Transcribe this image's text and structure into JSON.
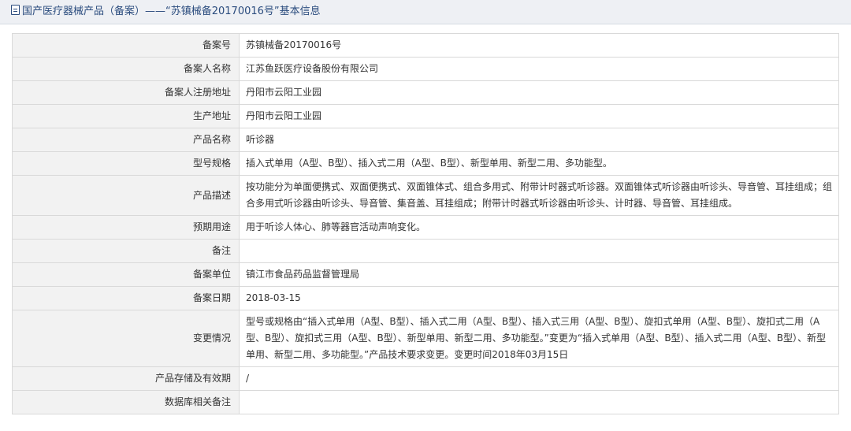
{
  "header": {
    "title": "国产医疗器械产品（备案）——“苏镇械备20170016号”基本信息",
    "icon": "document-icon"
  },
  "colors": {
    "title_text": "#2b4c7e",
    "title_bg": "#eef0f4",
    "label_bg": "#f2f2f2",
    "border": "#d9d9d9"
  },
  "rows": [
    {
      "label": "备案号",
      "value": "苏镇械备20170016号"
    },
    {
      "label": "备案人名称",
      "value": "江苏鱼跃医疗设备股份有限公司"
    },
    {
      "label": "备案人注册地址",
      "value": "丹阳市云阳工业园"
    },
    {
      "label": "生产地址",
      "value": "丹阳市云阳工业园"
    },
    {
      "label": "产品名称",
      "value": "听诊器"
    },
    {
      "label": "型号规格",
      "value": "插入式单用（A型、B型）、插入式二用（A型、B型）、新型单用、新型二用、多功能型。"
    },
    {
      "label": "产品描述",
      "value": "按功能分为单面便携式、双面便携式、双面锥体式、组合多用式、附带计时器式听诊器。双面锥体式听诊器由听诊头、导音管、耳挂组成；组合多用式听诊器由听诊头、导音管、集音盖、耳挂组成；附带计时器式听诊器由听诊头、计时器、导音管、耳挂组成。"
    },
    {
      "label": "预期用途",
      "value": "用于听诊人体心、肺等器官活动声响变化。"
    },
    {
      "label": "备注",
      "value": ""
    },
    {
      "label": "备案单位",
      "value": "镇江市食品药品监督管理局"
    },
    {
      "label": "备案日期",
      "value": "2018-03-15"
    },
    {
      "label": "变更情况",
      "value": "型号或规格由“插入式单用（A型、B型）、插入式二用（A型、B型）、插入式三用（A型、B型）、旋扣式单用（A型、B型）、旋扣式二用（A型、B型）、旋扣式三用（A型、B型）、新型单用、新型二用、多功能型。”变更为“插入式单用（A型、B型）、插入式二用（A型、B型）、新型单用、新型二用、多功能型。”产品技术要求变更。变更时间2018年03月15日"
    },
    {
      "label": "产品存储及有效期",
      "value": "/"
    },
    {
      "label": "数据库相关备注",
      "value": ""
    }
  ]
}
